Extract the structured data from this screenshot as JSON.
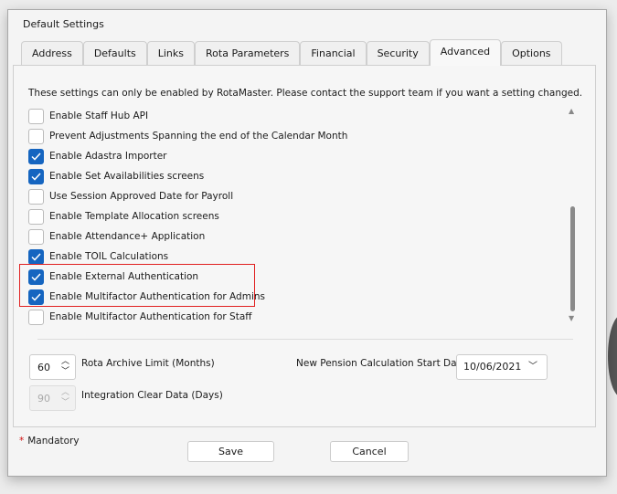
{
  "window": {
    "title": "Default Settings"
  },
  "tabs": [
    {
      "label": "Address"
    },
    {
      "label": "Defaults"
    },
    {
      "label": "Links"
    },
    {
      "label": "Rota Parameters"
    },
    {
      "label": "Financial"
    },
    {
      "label": "Security"
    },
    {
      "label": "Advanced",
      "active": true
    },
    {
      "label": "Options"
    }
  ],
  "advanced": {
    "note": "These settings can only be enabled by RotaMaster. Please contact the support team if you want a setting changed.",
    "settings": [
      {
        "label": "Enable Staff Hub API",
        "checked": false
      },
      {
        "label": "Prevent Adjustments Spanning the end of the Calendar Month",
        "checked": false
      },
      {
        "label": "Enable Adastra Importer",
        "checked": true
      },
      {
        "label": "Enable Set Availabilities screens",
        "checked": true
      },
      {
        "label": "Use Session Approved Date for Payroll",
        "checked": false
      },
      {
        "label": "Enable Template Allocation screens",
        "checked": false
      },
      {
        "label": "Enable Attendance+ Application",
        "checked": false
      },
      {
        "label": "Enable TOIL Calculations",
        "checked": true
      },
      {
        "label": "Enable External Authentication",
        "checked": true,
        "highlighted": true
      },
      {
        "label": "Enable Multifactor Authentication for Admins",
        "checked": true,
        "highlighted": true
      },
      {
        "label": "Enable Multifactor Authentication for Staff",
        "checked": false
      }
    ],
    "rota_archive": {
      "value": "60",
      "label": "Rota Archive Limit (Months)"
    },
    "integration_clear": {
      "value": "90",
      "label": "Integration Clear Data (Days)",
      "disabled": true
    },
    "pension": {
      "label": "New Pension Calculation Start Date",
      "value": "10/06/2021"
    }
  },
  "footer": {
    "mandatory": "Mandatory",
    "save": "Save",
    "cancel": "Cancel"
  },
  "colors": {
    "checkbox_checked": "#1565c0",
    "highlight_border": "#e02020",
    "mandatory_star": "#d01010"
  }
}
